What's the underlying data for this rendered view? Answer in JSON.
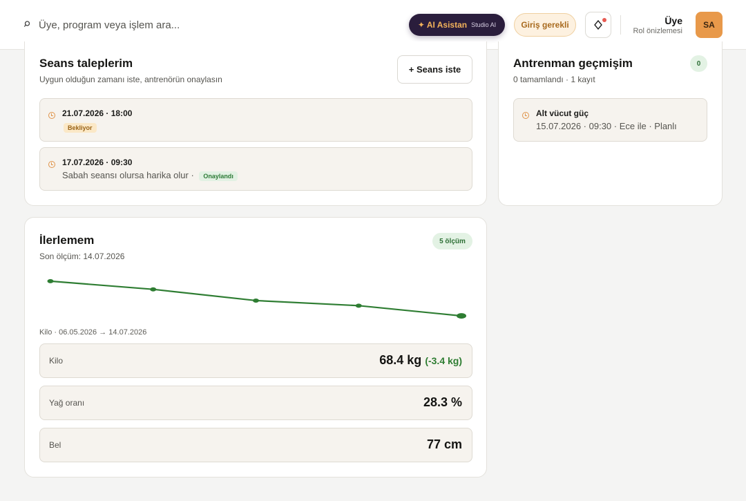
{
  "header": {
    "search_placeholder": "Üye, program veya işlem ara...",
    "ai_button": {
      "label": "✦ AI Asistan",
      "sub": "Studio AI"
    },
    "login_button": "Giriş gerekli",
    "user": {
      "role": "Üye",
      "subtitle": "Rol önizlemesi",
      "initials": "SA"
    }
  },
  "sessions": {
    "title": "Seans taleplerim",
    "subtitle": "Uygun olduğun zamanı iste, antrenörün onaylasın",
    "request_button": "+ Seans iste",
    "items": [
      {
        "datetime": "21.07.2026 · 18:00",
        "status": "Bekliyor"
      },
      {
        "datetime": "17.07.2026 · 09:30",
        "note": "Sabah seansı olursa harika olur ·",
        "status": "Onaylandı"
      }
    ]
  },
  "history": {
    "title": "Antrenman geçmişim",
    "subtitle": "0 tamamlandı · 1 kayıt",
    "count": "0",
    "items": [
      {
        "title": "Alt vücut güç",
        "detail": "15.07.2026 · 09:30 · Ece ile · Planlı"
      }
    ]
  },
  "progress": {
    "title": "İlerlemem",
    "subtitle": "Son ölçüm: 14.07.2026",
    "badge": "5 ölçüm",
    "caption": "Kilo · 06.05.2026 → 14.07.2026",
    "metrics": [
      {
        "label": "Kilo",
        "value": "68.4 kg",
        "delta": "(-3.4 kg)"
      },
      {
        "label": "Yağ oranı",
        "value": "28.3 %"
      },
      {
        "label": "Bel",
        "value": "77 cm"
      }
    ]
  },
  "chart_data": {
    "type": "line",
    "series": [
      {
        "values": [
          71.8,
          71.0,
          69.9,
          69.4,
          68.4
        ]
      }
    ],
    "ylim": [
      68.0,
      72.2
    ],
    "grid": false,
    "color": "#2e7d32"
  }
}
